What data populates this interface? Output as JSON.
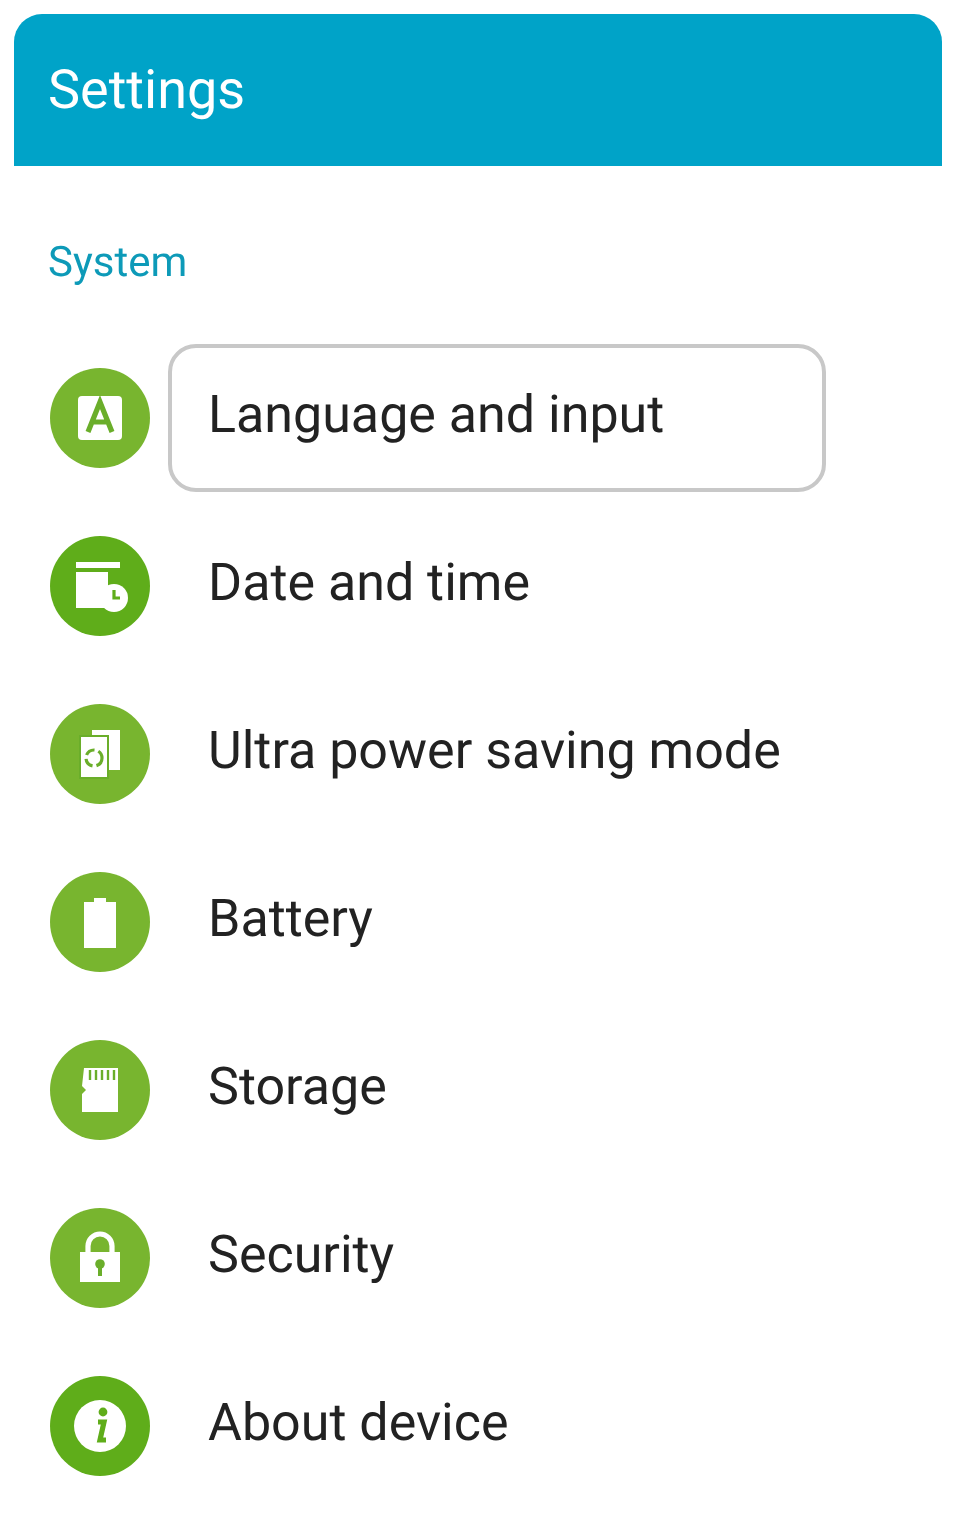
{
  "header": {
    "title": "Settings"
  },
  "section": {
    "title": "System"
  },
  "items": [
    {
      "kind": "language",
      "label": "Language and input",
      "focused": true
    },
    {
      "kind": "datetime",
      "label": "Date and time",
      "focused": false
    },
    {
      "kind": "powersaving",
      "label": "Ultra power saving mode",
      "focused": false
    },
    {
      "kind": "battery",
      "label": "Battery",
      "focused": false
    },
    {
      "kind": "storage",
      "label": "Storage",
      "focused": false
    },
    {
      "kind": "security",
      "label": "Security",
      "focused": false
    },
    {
      "kind": "about",
      "label": "About device",
      "focused": false
    }
  ]
}
